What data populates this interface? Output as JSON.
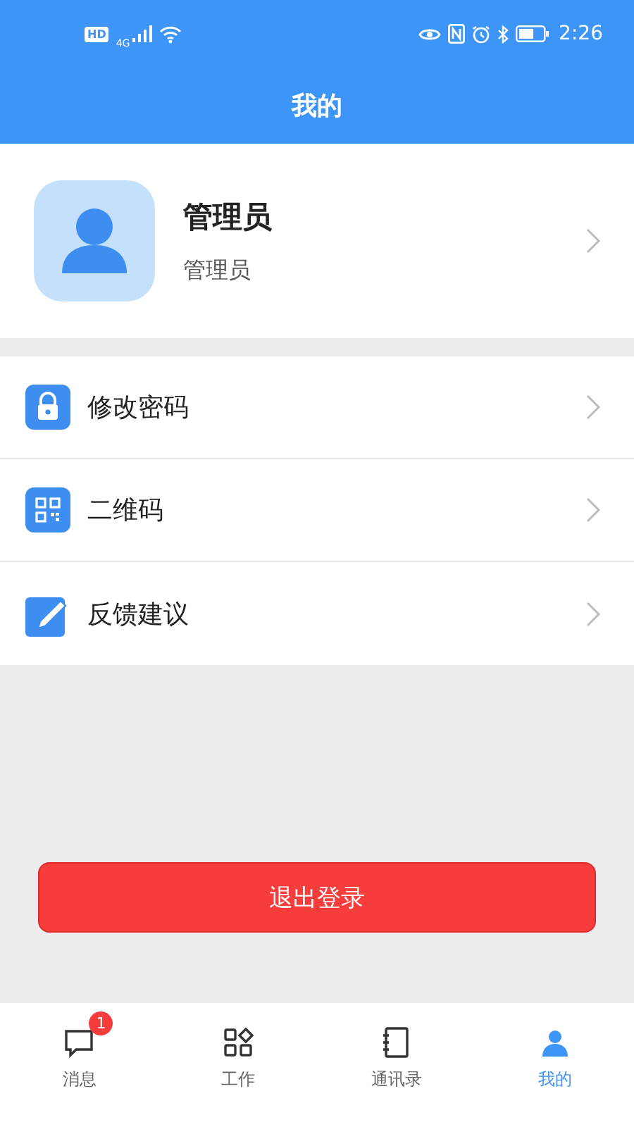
{
  "status_bar": {
    "left": "HD",
    "network": "4G",
    "time": "2:26"
  },
  "header": {
    "title": "我的"
  },
  "profile": {
    "name": "管理员",
    "role": "管理员"
  },
  "menu": [
    {
      "kind": "lock",
      "label": "修改密码"
    },
    {
      "kind": "qr",
      "label": "二维码"
    },
    {
      "kind": "edit",
      "label": "反馈建议"
    }
  ],
  "logout_button": "退出登录",
  "tabs": [
    {
      "kind": "chat",
      "label": "消息",
      "selected": false,
      "badge": "1"
    },
    {
      "kind": "grid",
      "label": "工作",
      "selected": false
    },
    {
      "kind": "contacts",
      "label": "通讯录",
      "selected": false
    },
    {
      "kind": "person",
      "label": "我的",
      "selected": true
    }
  ]
}
